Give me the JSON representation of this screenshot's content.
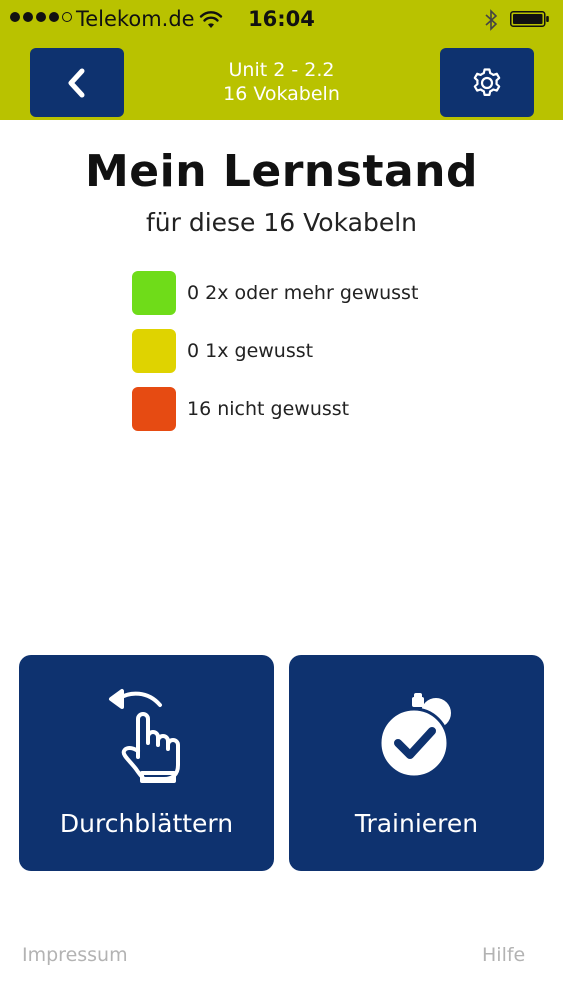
{
  "status_bar": {
    "carrier": "Telekom.de",
    "time": "16:04"
  },
  "nav": {
    "title_line1": "Unit 2 - 2.2",
    "title_line2": "16 Vokabeln",
    "back_icon": "chevron-left-icon",
    "settings_icon": "gear-icon"
  },
  "content": {
    "title": "Mein Lernstand",
    "subtitle": "für diese 16 Vokabeln"
  },
  "legend": {
    "items": [
      {
        "count": "0",
        "label": "2x oder mehr gewusst",
        "color": "#6fdc19"
      },
      {
        "count": "0",
        "label": "1x gewusst",
        "color": "#dfd300"
      },
      {
        "count": "16",
        "label": "nicht gewusst",
        "color": "#e64b12"
      }
    ]
  },
  "actions": {
    "browse_label": "Durchblättern",
    "browse_icon": "swipe-hand-icon",
    "train_label": "Trainieren",
    "train_icon": "stopwatch-check-icon"
  },
  "footer": {
    "impressum": "Impressum",
    "hilfe": "Hilfe"
  },
  "colors": {
    "header": "#b9c200",
    "nav_button": "#0e326f",
    "action_button": "#0e326f",
    "footer_text": "#b3b3b3"
  }
}
